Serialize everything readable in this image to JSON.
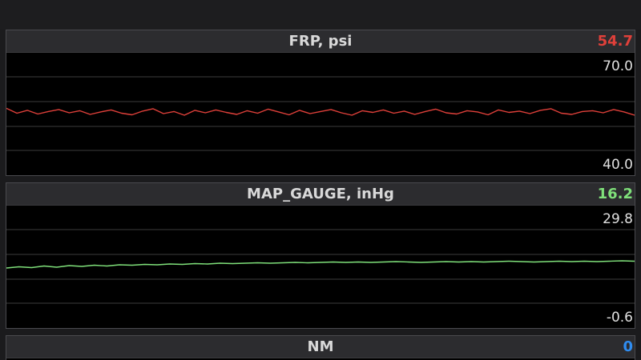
{
  "panels": [
    {
      "title": "FRP, psi",
      "current_value": "54.7",
      "value_color": "#e0403a",
      "axis_max": "70.0",
      "axis_min": "40.0",
      "line_color": "#e0403a"
    },
    {
      "title": "MAP_GAUGE, inHg",
      "current_value": "16.2",
      "value_color": "#7fe07a",
      "axis_max": "29.8",
      "axis_min": "-0.6",
      "line_color": "#7fe07a"
    },
    {
      "title": "NM",
      "current_value": "0",
      "value_color": "#2f8cf0"
    }
  ],
  "chart_data": [
    {
      "type": "line",
      "title": "FRP, psi",
      "ylim": [
        40.0,
        70.0
      ],
      "series": [
        {
          "values": [
            56.4,
            55.2,
            55.9,
            55.0,
            55.6,
            56.1,
            55.3,
            55.8,
            54.9,
            55.5,
            56.0,
            55.2,
            54.8,
            55.7,
            56.3,
            55.1,
            55.6,
            54.7,
            55.9,
            55.3,
            56.0,
            55.4,
            54.9,
            55.8,
            55.2,
            56.2,
            55.5,
            54.8,
            55.9,
            55.1,
            55.6,
            56.1,
            55.3,
            54.7,
            55.8,
            55.4,
            56.0,
            55.2,
            55.7,
            54.9,
            55.6,
            56.2,
            55.3,
            55.0,
            55.8,
            55.5,
            54.8,
            56.0,
            55.4,
            55.7,
            55.1,
            55.9,
            56.3,
            55.2,
            54.9,
            55.6,
            55.8,
            55.3,
            56.1,
            55.5,
            54.7
          ]
        }
      ]
    },
    {
      "type": "line",
      "title": "MAP_GAUGE, inHg",
      "ylim": [
        -0.6,
        29.8
      ],
      "series": [
        {
          "values": [
            14.3,
            14.6,
            14.4,
            14.8,
            14.5,
            14.9,
            14.7,
            15.0,
            14.8,
            15.1,
            15.0,
            15.2,
            15.1,
            15.3,
            15.2,
            15.4,
            15.3,
            15.5,
            15.4,
            15.5,
            15.6,
            15.5,
            15.6,
            15.7,
            15.6,
            15.7,
            15.8,
            15.7,
            15.8,
            15.7,
            15.8,
            15.9,
            15.8,
            15.7,
            15.8,
            15.9,
            15.8,
            15.9,
            15.8,
            15.9,
            16.0,
            15.9,
            15.8,
            15.9,
            16.0,
            15.9,
            16.0,
            15.9,
            16.0,
            16.1,
            16.0
          ]
        }
      ]
    }
  ]
}
